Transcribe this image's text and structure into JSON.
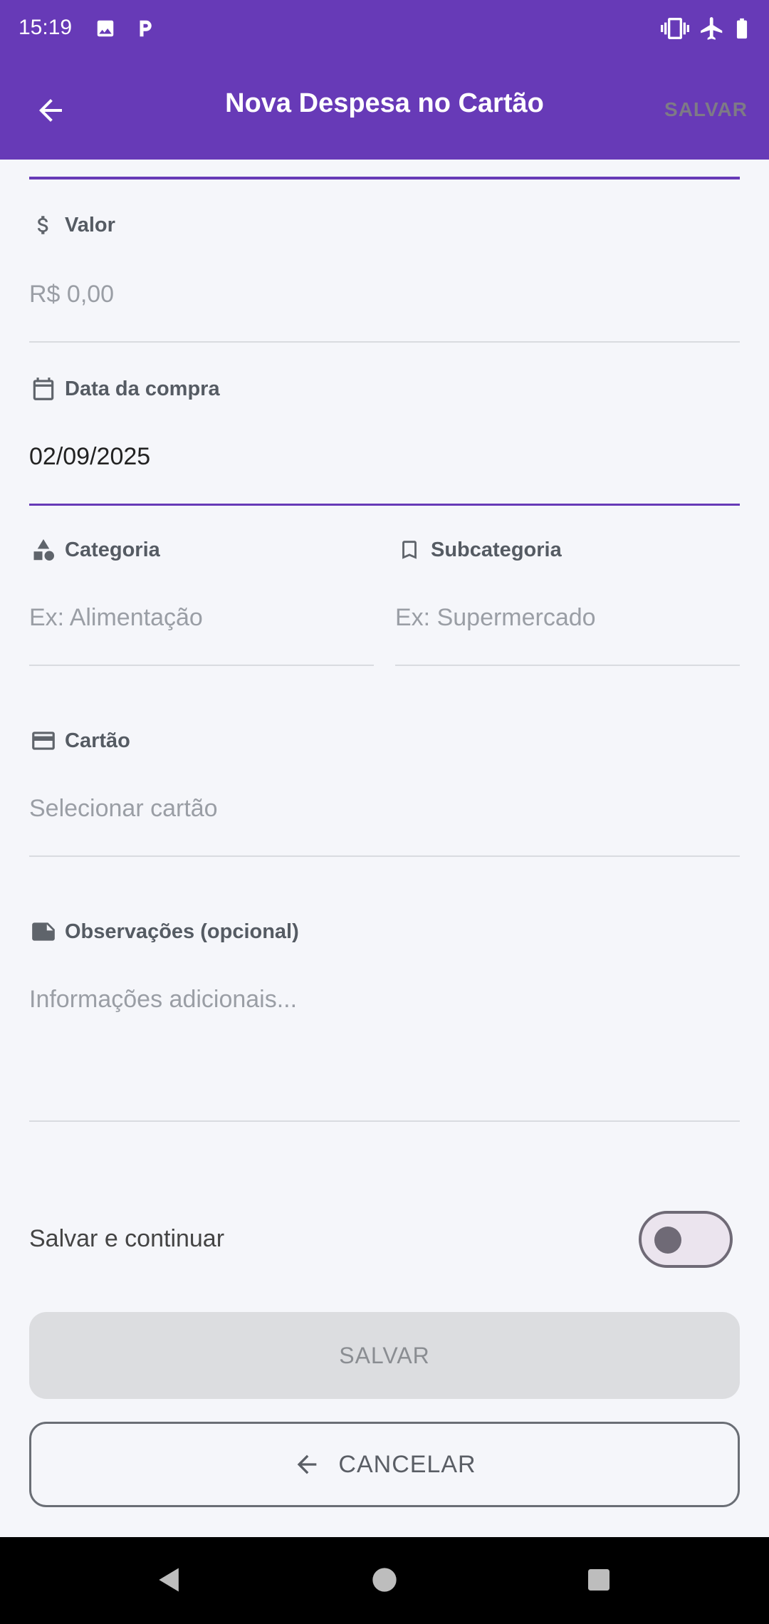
{
  "status_bar": {
    "time": "15:19"
  },
  "app_bar": {
    "title": "Nova Despesa no Cartão",
    "action_save": "SALVAR"
  },
  "form": {
    "valor": {
      "label": "Valor",
      "placeholder": "R$ 0,00"
    },
    "data": {
      "label": "Data da compra",
      "value": "02/09/2025"
    },
    "categoria": {
      "label": "Categoria",
      "placeholder": "Ex: Alimentação"
    },
    "subcategoria": {
      "label": "Subcategoria",
      "placeholder": "Ex: Supermercado"
    },
    "cartao": {
      "label": "Cartão",
      "placeholder": "Selecionar cartão"
    },
    "observacoes": {
      "label": "Observações (opcional)",
      "placeholder": "Informações adicionais..."
    }
  },
  "toggle": {
    "label": "Salvar e continuar",
    "on": false
  },
  "buttons": {
    "save": "SALVAR",
    "cancel": "CANCELAR"
  },
  "colors": {
    "primary": "#673ab7",
    "background": "#f5f6fa"
  },
  "icons": [
    "gallery-icon",
    "p-app-icon",
    "vibrate-icon",
    "airplane-icon",
    "battery-icon",
    "arrow-back-icon",
    "dollar-icon",
    "calendar-icon",
    "shapes-icon",
    "bookmark-icon",
    "credit-card-icon",
    "note-icon",
    "nav-back-icon",
    "nav-home-icon",
    "nav-recents-icon"
  ]
}
